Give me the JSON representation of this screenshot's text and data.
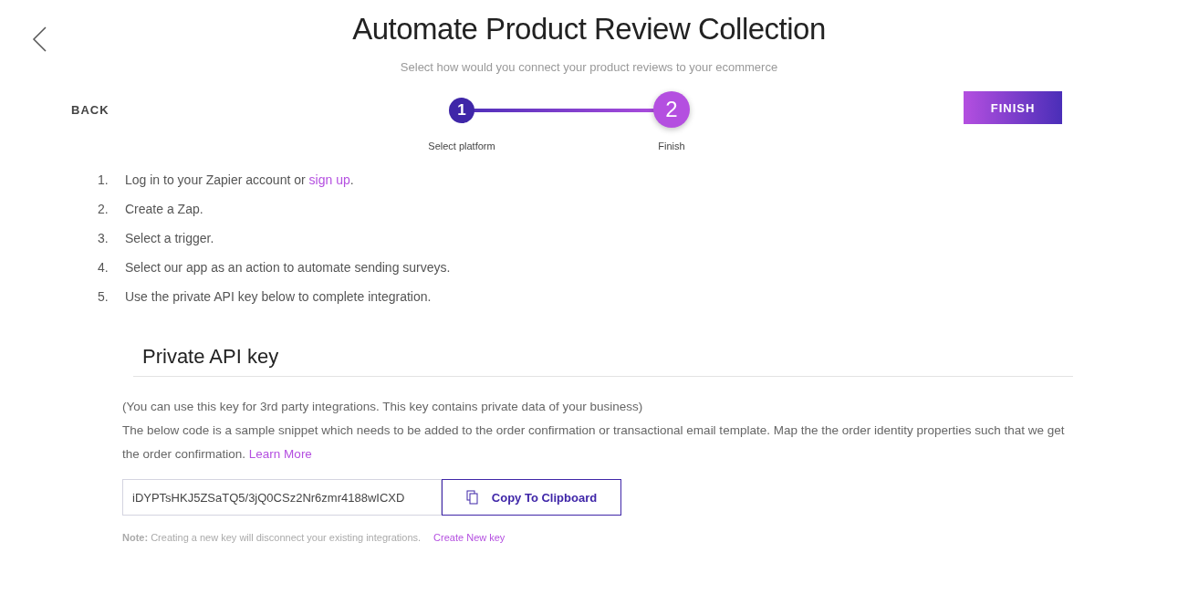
{
  "header": {
    "title": "Automate Product Review Collection",
    "subtitle": "Select how would you connect your product reviews to your ecommerce"
  },
  "back_button": "BACK",
  "finish_button": "FINISH",
  "stepper": [
    {
      "number": "1",
      "label": "Select platform",
      "selected": false
    },
    {
      "number": "2",
      "label": "Finish",
      "selected": true
    }
  ],
  "steps": [
    {
      "number": "1.",
      "text": "Log in to your Zapier account or ",
      "link": "sign up",
      "after": "."
    },
    {
      "number": "2.",
      "text": "Create a Zap."
    },
    {
      "number": "3.",
      "text": "Select a trigger."
    },
    {
      "number": "4.",
      "text": "Select our app as an action to automate sending surveys."
    },
    {
      "number": "5.",
      "text": "Use the private API key below to complete integration."
    }
  ],
  "api_key": {
    "heading": "Private API key",
    "note1": "(You can use this key for 3rd party integrations. This key contains private data of your business)",
    "note2": "The below code is a sample snippet which needs to be added to the order confirmation or transactional email template. Map the the order identity properties such that we get the order confirmation.",
    "learn_more": "Learn More",
    "value": "iDYPTsHKJ5ZSaTQ5/3jQ0CSz2Nr6zmr4188wICXD",
    "copy_button": "Copy To Clipboard",
    "note_label": "Note:",
    "note_text": "Creating a new key will disconnect your existing integrations.",
    "create_link": "Create New key"
  }
}
